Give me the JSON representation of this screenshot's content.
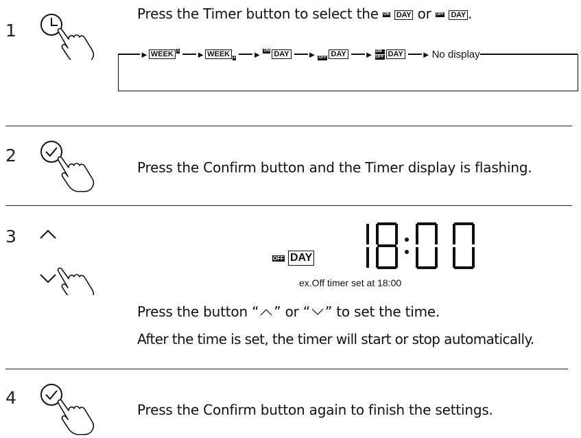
{
  "steps": [
    {
      "number": "1",
      "text": "Press the Timer button to select the",
      "or": "or"
    },
    {
      "number": "2",
      "text": "Press the Confirm button and the Timer display is flashing."
    },
    {
      "number": "3",
      "line1_a": "Press the button “",
      "line1_b": "” or “",
      "line1_c": "” to set the time.",
      "line2": "After the time is set, the timer will start or stop automatically."
    },
    {
      "number": "4",
      "text": "Press the Confirm button again to finish the settings."
    }
  ],
  "labels": {
    "day": "DAY",
    "week": "WEEK",
    "on": "ON",
    "off": "OFF",
    "one": "1",
    "two": "2",
    "no_display": "No display"
  },
  "display": {
    "time": "18:00",
    "caption": "ex.Off timer set at 18:00"
  },
  "icons": [
    "timer-clock-icon",
    "hand-press-icon",
    "confirm-check-icon",
    "up-arrow-icon",
    "down-arrow-icon"
  ]
}
